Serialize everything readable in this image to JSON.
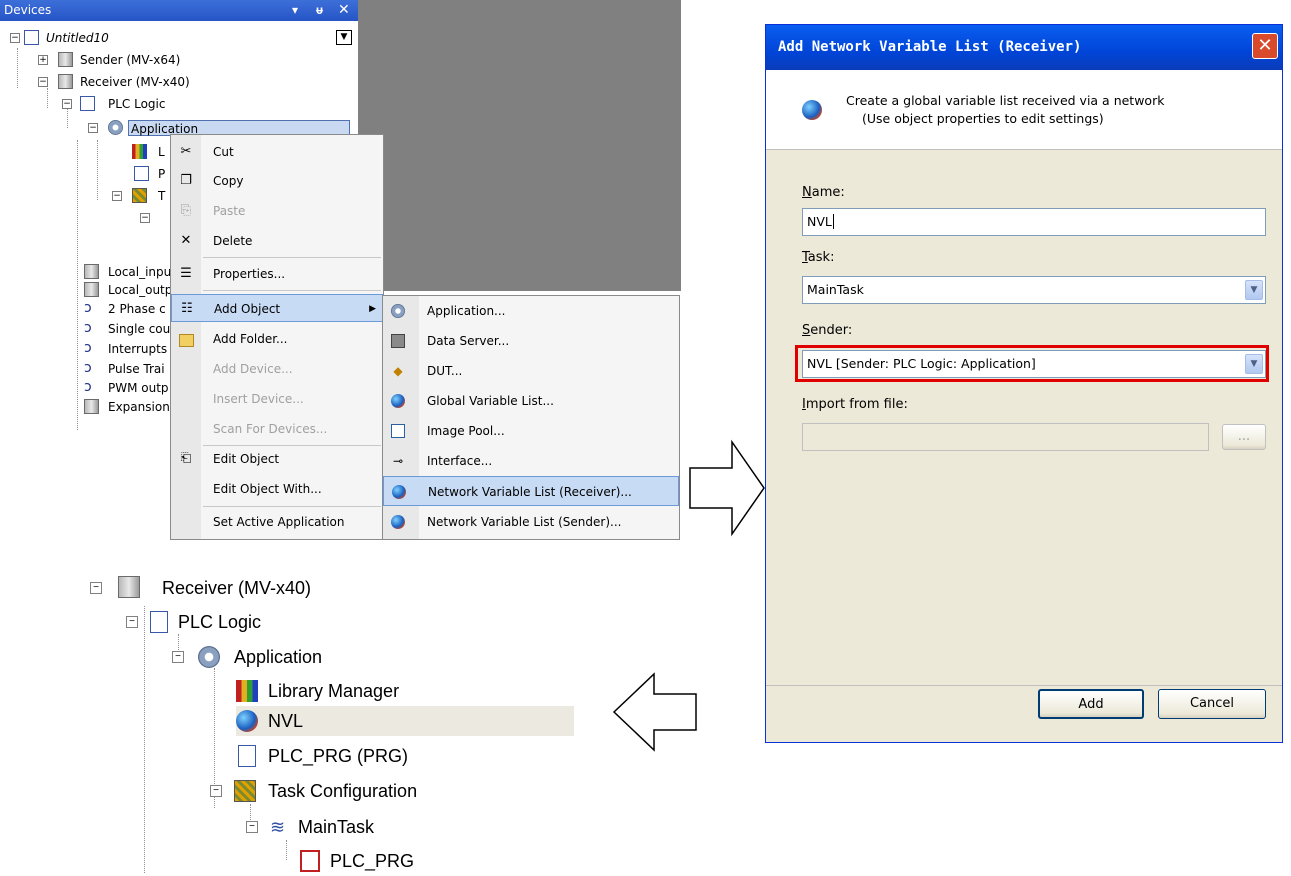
{
  "devices_panel": {
    "title": "Devices",
    "pin_glyph": "▾  p  ×",
    "tree": {
      "root": "Untitled10",
      "sender": "Sender (MV-x64)",
      "receiver": "Receiver (MV-x40)",
      "plc_logic": "PLC Logic",
      "application": "Application",
      "lib_partial": "L",
      "plc_partial": "P",
      "task_partial": "T",
      "local_inp": "Local_inpu",
      "local_out": "Local_outp",
      "phase": "2 Phase c",
      "single": "Single cou",
      "interrupts": "Interrupts",
      "pulse": "Pulse Trai",
      "pwm": "PWM outp",
      "expansion": "Expansion"
    }
  },
  "context_menu": {
    "items": [
      {
        "label": "Cut",
        "icon": "scissors-icon",
        "glyph": "✂",
        "disabled": false
      },
      {
        "label": "Copy",
        "icon": "copy-icon",
        "glyph": "❐",
        "disabled": false
      },
      {
        "label": "Paste",
        "icon": "paste-icon",
        "glyph": "⎘",
        "disabled": true
      },
      {
        "label": "Delete",
        "icon": "delete-icon",
        "glyph": "✕",
        "disabled": false
      },
      {
        "label": "Properties...",
        "icon": "properties-icon",
        "glyph": "☰",
        "disabled": false
      },
      {
        "label": "Add Object",
        "icon": "add-object-icon",
        "glyph": "☷",
        "disabled": false
      },
      {
        "label": "Add Folder...",
        "icon": "folder-icon",
        "glyph": "",
        "disabled": false
      },
      {
        "label": "Add Device...",
        "icon": "",
        "glyph": "",
        "disabled": true
      },
      {
        "label": "Insert Device...",
        "icon": "",
        "glyph": "",
        "disabled": true
      },
      {
        "label": "Scan For Devices...",
        "icon": "",
        "glyph": "",
        "disabled": true
      },
      {
        "label": "Edit Object",
        "icon": "edit-object-icon",
        "glyph": "⎗",
        "disabled": false
      },
      {
        "label": "Edit Object With...",
        "icon": "",
        "glyph": "",
        "disabled": false
      },
      {
        "label": "Set Active Application",
        "icon": "",
        "glyph": "",
        "disabled": false
      }
    ],
    "submenu_arrow": "▶"
  },
  "submenu": {
    "items": [
      {
        "label": "Application...",
        "icon": "gear-icon"
      },
      {
        "label": "Data Server...",
        "icon": "data-server-icon"
      },
      {
        "label": "DUT...",
        "icon": "dut-icon"
      },
      {
        "label": "Global Variable List...",
        "icon": "globe-icon"
      },
      {
        "label": "Image Pool...",
        "icon": "image-pool-icon"
      },
      {
        "label": "Interface...",
        "icon": "interface-icon"
      },
      {
        "label": "Network Variable List (Receiver)...",
        "icon": "globe-icon"
      },
      {
        "label": "Network Variable List (Sender)...",
        "icon": "globe-icon"
      }
    ]
  },
  "dialog": {
    "title": "Add Network Variable List (Receiver)",
    "close_glyph": "✕",
    "description_line1": "Create a global variable list received via a network",
    "description_line2": "(Use object properties to edit settings)",
    "name_label_key": "N",
    "name_label_rest": "ame:",
    "name_value": "NVL",
    "task_label_key": "T",
    "task_label_rest": "ask:",
    "task_value": "MainTask",
    "sender_label_key": "S",
    "sender_label_rest": "ender:",
    "sender_value": "NVL [Sender: PLC Logic: Application]",
    "import_label_key": "I",
    "import_label_rest": "mport from file:",
    "import_value": "",
    "browse_label": "...",
    "add_label": "Add",
    "cancel_label": "Cancel",
    "dropdown_glyph": "▼"
  },
  "result_tree": {
    "receiver": "Receiver (MV-x40)",
    "plc_logic": "PLC Logic",
    "application": "Application",
    "library_manager": "Library Manager",
    "nvl": "NVL",
    "plc_prg": "PLC_PRG (PRG)",
    "task_configuration": "Task Configuration",
    "main_task": "MainTask",
    "plc_prg_call": "PLC_PRG"
  }
}
